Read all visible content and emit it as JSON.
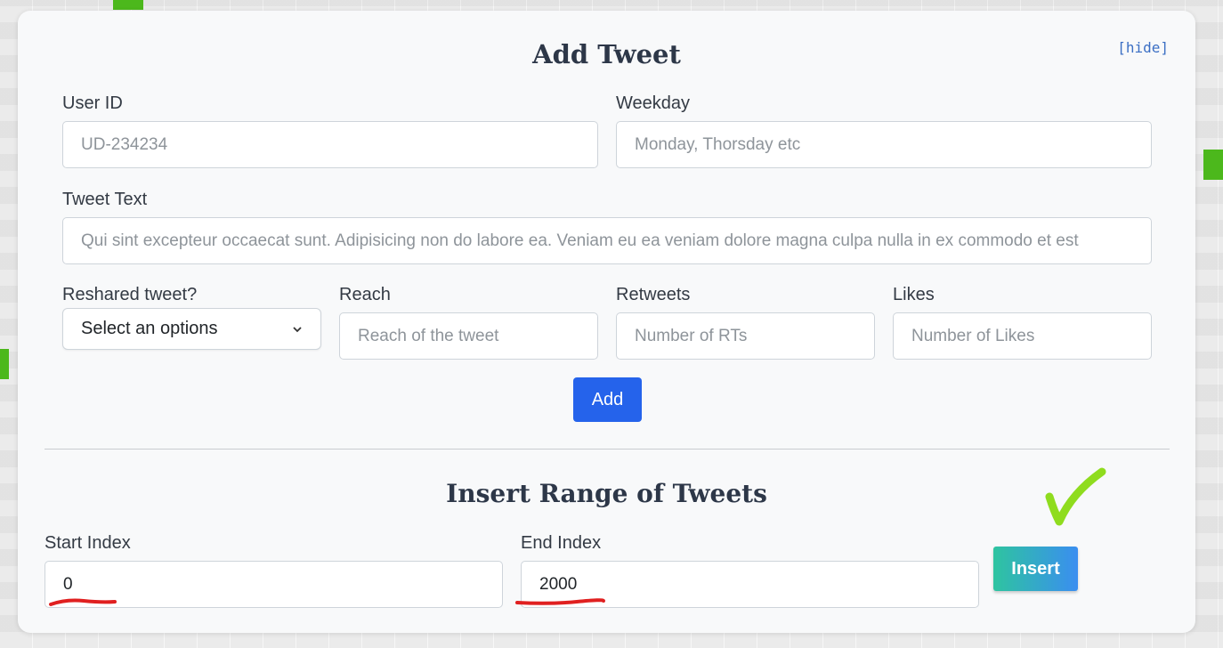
{
  "colors": {
    "accent_blue": "#2563eb",
    "insert_gradient_start": "#2ec4a0",
    "insert_gradient_end": "#3a8ef0",
    "annotation_red": "#e02020",
    "annotation_green": "#8fdc1e",
    "bg_tile_green": "#4cb81c"
  },
  "add_tweet": {
    "title": "Add Tweet",
    "hide_label": "[hide]",
    "user_id": {
      "label": "User ID",
      "placeholder": "UD-234234",
      "value": ""
    },
    "weekday": {
      "label": "Weekday",
      "placeholder": "Monday, Thorsday etc",
      "value": ""
    },
    "tweet_text": {
      "label": "Tweet Text",
      "placeholder": "Qui sint excepteur occaecat sunt. Adipisicing non do labore ea. Veniam eu ea veniam dolore magna culpa nulla in ex commodo et est",
      "value": ""
    },
    "reshared": {
      "label": "Reshared tweet?",
      "selected": "Select an options",
      "icon": "chevron-down-icon"
    },
    "reach": {
      "label": "Reach",
      "placeholder": "Reach of the tweet",
      "value": ""
    },
    "retweets": {
      "label": "Retweets",
      "placeholder": "Number of RTs",
      "value": ""
    },
    "likes": {
      "label": "Likes",
      "placeholder": "Number of Likes",
      "value": ""
    },
    "add_button": "Add"
  },
  "insert_range": {
    "title": "Insert Range of Tweets",
    "start_index": {
      "label": "Start Index",
      "value": "0"
    },
    "end_index": {
      "label": "End Index",
      "value": "2000"
    },
    "insert_button": "Insert"
  },
  "annotations": {
    "underline_icon": "red-underline-icon",
    "checkmark_icon": "green-checkmark-icon"
  }
}
